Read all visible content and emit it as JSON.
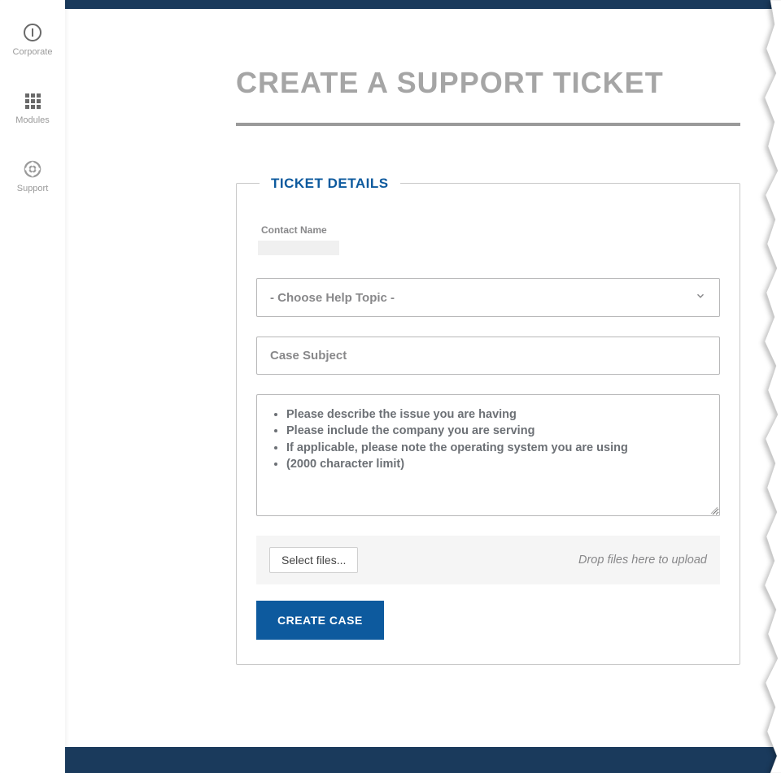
{
  "sidebar": {
    "items": [
      {
        "label": "Corporate",
        "icon": "corporate-icon"
      },
      {
        "label": "Modules",
        "icon": "modules-icon"
      },
      {
        "label": "Support",
        "icon": "support-icon"
      }
    ]
  },
  "page": {
    "title": "CREATE A SUPPORT TICKET"
  },
  "form": {
    "legend": "TICKET DETAILS",
    "contact_name_label": "Contact Name",
    "contact_name_value": "",
    "help_topic_placeholder": "- Choose Help Topic -",
    "subject_placeholder": "Case Subject",
    "description_bullets": [
      "Please describe the issue you are having",
      "Please include the company you are serving",
      "If applicable, please note the operating system you are using",
      "(2000 character limit)"
    ],
    "select_files_label": "Select files...",
    "drop_hint": "Drop files here to upload",
    "submit_label": "CREATE CASE"
  }
}
